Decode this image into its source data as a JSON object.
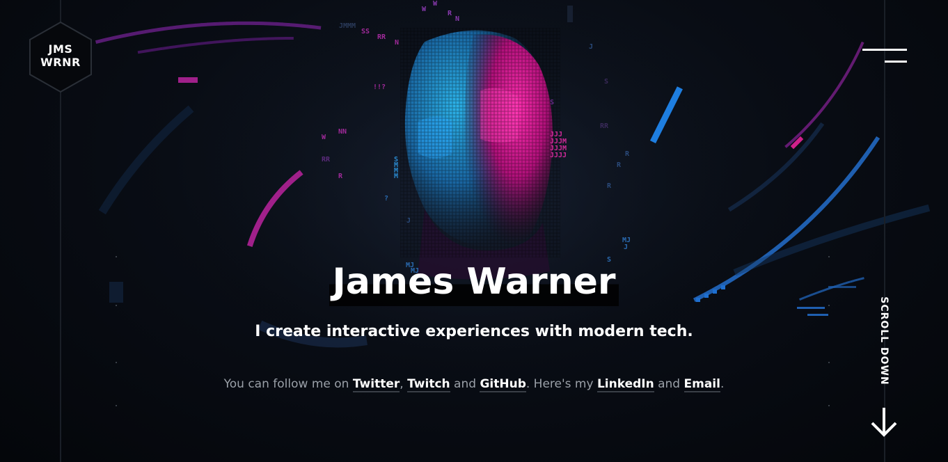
{
  "logo": {
    "line1": "JMS",
    "line2": "WRNR"
  },
  "menu": {
    "icon": "hamburger-menu-icon"
  },
  "hero": {
    "title": "James Warner",
    "subtitle": "I create interactive experiences with modern tech.",
    "follow": {
      "prefix": "You can follow me on ",
      "twitter": "Twitter",
      "sep1": ", ",
      "twitch": "Twitch",
      "and1": " and ",
      "github": "GitHub",
      "mid": ". Here's my ",
      "linkedin": "LinkedIn",
      "and2": " and ",
      "email": "Email",
      "suffix": "."
    }
  },
  "scroll": {
    "label": "SCROLL DOWN",
    "icon": "arrow-down-icon"
  },
  "colors": {
    "background": "#05070b",
    "accent_pink": "#ff1fa0",
    "accent_blue": "#1e90ff",
    "accent_purple": "#8a2bd6",
    "text_muted": "#9aa0a8"
  },
  "background_glyphs": [
    "W",
    "W",
    "R",
    "N",
    "JMMM",
    "SS",
    "RR",
    "N",
    "!!?",
    "NN",
    "W",
    "RR",
    "R",
    "SMMM",
    "MJ",
    "MJ",
    "JJJJ",
    "R",
    "R",
    "S",
    "MJ",
    "?",
    "J",
    "S"
  ]
}
